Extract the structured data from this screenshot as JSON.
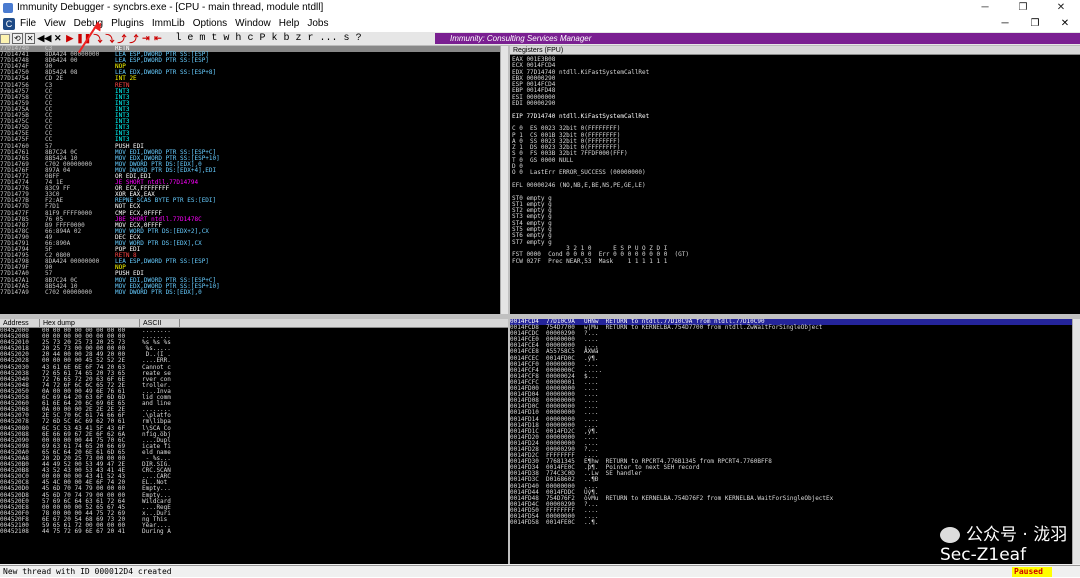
{
  "window": {
    "title": "Immunity Debugger - syncbrs.exe - [CPU - main thread, module ntdll]",
    "min": "─",
    "max": "❐",
    "close": "✕"
  },
  "menu": [
    "File",
    "View",
    "Debug",
    "Plugins",
    "ImmLib",
    "Options",
    "Window",
    "Help",
    "Jobs"
  ],
  "mdi": {
    "min": "─",
    "restore": "❐",
    "close": "✕"
  },
  "toolbar": {
    "buttons": [
      "◀◀",
      "✕",
      "▶",
      "❚❚",
      "⤵",
      "⤵",
      "⤴",
      "⤴",
      "⇥",
      "⇤"
    ],
    "letters": [
      "l",
      "e",
      "m",
      "t",
      "w",
      "h",
      "c",
      "P",
      "k",
      "b",
      "z",
      "r",
      "...",
      "s",
      "?"
    ],
    "banner": "Immunity: Consulting Services Manager"
  },
  "disasm": [
    [
      "77D14740",
      "C3",
      "RETN",
      "r"
    ],
    [
      "77D14741",
      "8DA424 00000000",
      "LEA ESP,DWORD PTR SS:[ESP]",
      "g"
    ],
    [
      "77D14748",
      "8D6424 00",
      "LEA ESP,DWORD PTR SS:[ESP]",
      "g"
    ],
    [
      "77D1474F",
      "90",
      "NOP",
      "y"
    ],
    [
      "77D14750",
      "8D5424 08",
      "LEA EDX,DWORD PTR SS:[ESP+8]",
      "g"
    ],
    [
      "77D14754",
      "CD 2E",
      "INT 2E",
      "y"
    ],
    [
      "77D14756",
      "C3",
      "RETN",
      "r"
    ],
    [
      "77D14757",
      "CC",
      "INT3",
      "c"
    ],
    [
      "77D14758",
      "CC",
      "INT3",
      "c"
    ],
    [
      "77D14759",
      "CC",
      "INT3",
      "c"
    ],
    [
      "77D1475A",
      "CC",
      "INT3",
      "c"
    ],
    [
      "77D1475B",
      "CC",
      "INT3",
      "c"
    ],
    [
      "77D1475C",
      "CC",
      "INT3",
      "c"
    ],
    [
      "77D1475D",
      "CC",
      "INT3",
      "c"
    ],
    [
      "77D1475E",
      "CC",
      "INT3",
      "c"
    ],
    [
      "77D1475F",
      "CC",
      "INT3",
      "c"
    ],
    [
      "77D14760",
      "57",
      "PUSH EDI",
      "w"
    ],
    [
      "77D14761",
      "8B7C24 0C",
      "MOV EDI,DWORD PTR SS:[ESP+C]",
      "g"
    ],
    [
      "77D14765",
      "8B5424 10",
      "MOV EDX,DWORD PTR SS:[ESP+10]",
      "g"
    ],
    [
      "77D14769",
      "C702 00000000",
      "MOV DWORD PTR DS:[EDX],0",
      "g"
    ],
    [
      "77D1476F",
      "897A 04",
      "MOV DWORD PTR DS:[EDX+4],EDI",
      "g"
    ],
    [
      "77D14772",
      "0BFF",
      "OR EDI,EDI",
      "w"
    ],
    [
      "77D14774",
      "74 1E",
      "JE SHORT ntdll.77D14794",
      "m"
    ],
    [
      "77D14776",
      "83C9 FF",
      "OR ECX,FFFFFFFF",
      "w"
    ],
    [
      "77D14779",
      "33C0",
      "XOR EAX,EAX",
      "w"
    ],
    [
      "77D1477B",
      "F2:AE",
      "REPNE SCAS BYTE PTR ES:[EDI]",
      "g"
    ],
    [
      "77D1477D",
      "F7D1",
      "NOT ECX",
      "w"
    ],
    [
      "77D1477F",
      "81F9 FFFF0000",
      "CMP ECX,0FFFF",
      "w"
    ],
    [
      "77D14785",
      "76 05",
      "JBE SHORT ntdll.77D1478C",
      "m"
    ],
    [
      "77D14787",
      "B9 FFFF0000",
      "MOV ECX,0FFFF",
      "w"
    ],
    [
      "77D1478C",
      "66:894A 02",
      "MOV WORD PTR DS:[EDX+2],CX",
      "g"
    ],
    [
      "77D14790",
      "49",
      "DEC ECX",
      "w"
    ],
    [
      "77D14791",
      "66:890A",
      "MOV WORD PTR DS:[EDX],CX",
      "g"
    ],
    [
      "77D14794",
      "5F",
      "POP EDI",
      "w"
    ],
    [
      "77D14795",
      "C2 0800",
      "RETN 8",
      "r"
    ],
    [
      "77D14798",
      "8DA424 00000000",
      "LEA ESP,DWORD PTR SS:[ESP]",
      "g"
    ],
    [
      "77D1479F",
      "90",
      "NOP",
      "y"
    ],
    [
      "77D147A0",
      "57",
      "PUSH EDI",
      "w"
    ],
    [
      "77D147A1",
      "8B7C24 0C",
      "MOV EDI,DWORD PTR SS:[ESP+C]",
      "g"
    ],
    [
      "77D147A5",
      "8B5424 10",
      "MOV EDX,DWORD PTR SS:[ESP+10]",
      "g"
    ],
    [
      "77D147A9",
      "C702 00000000",
      "MOV DWORD PTR DS:[EDX],0",
      "g"
    ]
  ],
  "registers": {
    "header": "Registers (FPU)",
    "lines": [
      "EAX 001E3B08",
      "ECX 0014FCD4",
      "EDX 77D14740 ntdll.KiFastSystemCallRet",
      "EBX 00000290",
      "ESP 0014FCD4",
      "EBP 0014FD48",
      "ESI 00000000",
      "EDI 00000290",
      "",
      "EIP 77D14740 ntdll.KiFastSystemCallRet",
      "",
      "C 0  ES 0023 32bit 0(FFFFFFFF)",
      "P 1  CS 001B 32bit 0(FFFFFFFF)",
      "A 0  SS 0023 32bit 0(FFFFFFFF)",
      "Z 1  DS 0023 32bit 0(FFFFFFFF)",
      "S 0  FS 003B 32bit 7FFDF000(FFF)",
      "T 0  GS 0000 NULL",
      "D 0",
      "O 0  LastErr ERROR_SUCCESS (00000000)",
      "",
      "EFL 00000246 (NO,NB,E,BE,NS,PE,GE,LE)",
      "",
      "ST0 empty g",
      "ST1 empty g",
      "ST2 empty g",
      "ST3 empty g",
      "ST4 empty g",
      "ST5 empty g",
      "ST6 empty g",
      "ST7 empty g",
      "               3 2 1 0      E S P U O Z D I",
      "FST 0000  Cond 0 0 0 0  Err 0 0 0 0 0 0 0 0  (GT)",
      "FCW 027F  Prec NEAR,53  Mask    1 1 1 1 1 1"
    ]
  },
  "dump": {
    "headers": [
      "Address",
      "Hex dump",
      "ASCII"
    ],
    "rows": [
      [
        "00452000",
        "00 00 00 00 00 00 00 00",
        "........"
      ],
      [
        "00452008",
        "00 00 00 00 00 00 00 00",
        "........"
      ],
      [
        "00452010",
        "25 73 20 25 73 20 25 73",
        "%s %s %s"
      ],
      [
        "00452018",
        "20 25 73 00 00 00 00 00",
        " %s....."
      ],
      [
        "00452020",
        "20 44 00 00 28 49 20 00",
        " D..(I ."
      ],
      [
        "00452028",
        "00 00 00 00 45 52 52 2E",
        "....ERR."
      ],
      [
        "00452030",
        "43 61 6E 6E 6F 74 20 63",
        "Cannot c"
      ],
      [
        "00452038",
        "72 65 61 74 65 20 73 65",
        "reate se"
      ],
      [
        "00452040",
        "72 76 65 72 20 63 6F 6E",
        "rver con"
      ],
      [
        "00452048",
        "74 72 6F 6C 6C 65 72 2E",
        "troller."
      ],
      [
        "00452050",
        "0A 00 00 00 49 6E 76 61",
        "....Inva"
      ],
      [
        "00452058",
        "6C 69 64 20 63 6F 6D 6D",
        "lid comm"
      ],
      [
        "00452060",
        "61 6E 64 20 6C 69 6E 65",
        "and line"
      ],
      [
        "00452068",
        "0A 00 00 00 2E 2E 2E 2E",
        "........"
      ],
      [
        "00452070",
        "2E 5C 70 6C 61 74 66 6F",
        ".\\platfo"
      ],
      [
        "00452078",
        "72 6D 5C 6C 69 62 70 61",
        "rm\\libpa"
      ],
      [
        "00452080",
        "6C 5C 53 43 41 5F 43 6F",
        "l\\SCA_Co"
      ],
      [
        "00452088",
        "6E 66 69 67 2E 6F 62 6A",
        "nfig.obj"
      ],
      [
        "00452090",
        "00 00 00 00 44 75 70 6C",
        "....Dupl"
      ],
      [
        "00452098",
        "69 63 61 74 65 20 66 69",
        "icate fi"
      ],
      [
        "004520A0",
        "65 6C 64 20 6E 61 6D 65",
        "eld name"
      ],
      [
        "004520A8",
        "20 2D 20 25 73 00 00 00",
        " - %s..."
      ],
      [
        "004520B0",
        "44 49 52 00 53 49 47 2E",
        "DIR.SIG."
      ],
      [
        "004520B8",
        "43 52 43 00 53 43 41 4E",
        "CRC.SCAN"
      ],
      [
        "004520C0",
        "00 00 00 00 43 41 52 43",
        "....CARC"
      ],
      [
        "004520C8",
        "45 4C 00 00 4E 6F 74 20",
        "EL..Not "
      ],
      [
        "004520D0",
        "45 6D 70 74 79 00 00 00",
        "Empty..."
      ],
      [
        "004520D8",
        "45 6D 70 74 79 00 00 00",
        "Empty..."
      ],
      [
        "004520E0",
        "57 69 6C 64 63 61 72 64",
        "Wildcard"
      ],
      [
        "004520E8",
        "00 00 00 00 52 65 67 45",
        "....RegE"
      ],
      [
        "004520F0",
        "78 00 00 00 44 75 72 69",
        "x...Duri"
      ],
      [
        "004520F8",
        "6E 67 20 54 68 69 73 20",
        "ng This "
      ],
      [
        "00452100",
        "59 65 61 72 00 00 00 00",
        "Year...."
      ],
      [
        "00452108",
        "44 75 72 69 6E 67 20 41",
        "During A"
      ]
    ]
  },
  "stack": [
    [
      "0014FCD4",
      "77D10C9A",
      "ÜHÑw  RETURN to ntdll.77D10C9A from ntdll.77D10C90"
    ],
    [
      "0014FCD8",
      "754D7700",
      "w|Mu  RETURN to KERNELBA.754D7700 from ntdll.ZwWaitForSingleObject"
    ],
    [
      "0014FCDC",
      "00000290",
      "?..."
    ],
    [
      "0014FCE0",
      "00000000",
      "...."
    ],
    [
      "0014FCE4",
      "00000000",
      "...."
    ],
    [
      "0014FCE8",
      "A55758C5",
      "ÅXWå"
    ],
    [
      "0014FCEC",
      "0014FD0C",
      ".ý¶."
    ],
    [
      "0014FCF0",
      "00000000",
      "...."
    ],
    [
      "0014FCF4",
      "0000000C",
      "....."
    ],
    [
      "0014FCF8",
      "00000024",
      "$..."
    ],
    [
      "0014FCFC",
      "00000001",
      "...."
    ],
    [
      "0014FD00",
      "00000000",
      "...."
    ],
    [
      "0014FD04",
      "00000000",
      "...."
    ],
    [
      "0014FD08",
      "00000000",
      "...."
    ],
    [
      "0014FD0C",
      "00000000",
      "...."
    ],
    [
      "0014FD10",
      "00000000",
      "...."
    ],
    [
      "0014FD14",
      "00000000",
      "...."
    ],
    [
      "0014FD18",
      "00000000",
      "...."
    ],
    [
      "0014FD1C",
      "0014FD2C",
      ",ý¶."
    ],
    [
      "0014FD20",
      "00000000",
      "...."
    ],
    [
      "0014FD24",
      "00000000",
      "...."
    ],
    [
      "0014FD28",
      "00000290",
      "?..."
    ],
    [
      "0014FD2C",
      "FFFFFFFF",
      "...."
    ],
    [
      "0014FD30",
      "77681345",
      "E¶hw  RETURN to RPCRT4.776B1345 from RPCRT4.7760BFF8"
    ],
    [
      "0014FD34",
      "0014FE0C",
      ".þ¶.  Pointer to next SEH record"
    ],
    [
      "0014FD38",
      "774C3C0D",
      "..Lw  SE handler"
    ],
    [
      "0014FD3C",
      "D0168602",
      "..¶Ð"
    ],
    [
      "0014FD40",
      "00000000",
      "...."
    ],
    [
      "0014FD44",
      "0014FDDC",
      "Üý¶."
    ],
    [
      "0014FD48",
      "754D76F2",
      "òvMu  RETURN to KERNELBA.754D76F2 from KERNELBA.WaitForSingleObjectEx"
    ],
    [
      "0014FD4C",
      "00000290",
      "?..."
    ],
    [
      "0014FD50",
      "FFFFFFFF",
      "...."
    ],
    [
      "0014FD54",
      "00000000",
      "...."
    ],
    [
      "0014FD58",
      "0014FE0C",
      "..¶."
    ]
  ],
  "status": {
    "message": "New thread with ID 000012D4 created",
    "state": "Paused"
  },
  "watermark": "公众号 · 泷羽Sec-Z1eaf"
}
